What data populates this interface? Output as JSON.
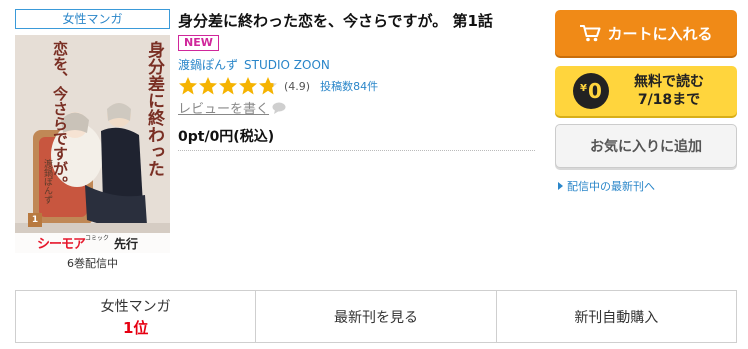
{
  "genre_tag": "女性マンガ",
  "cover": {
    "title_lines": [
      "身分差に",
      "終わった",
      "恋を、",
      "今さら",
      "ですが。"
    ],
    "author": "渡鍋ぽんず",
    "volume": "1",
    "label": "シーモア",
    "label_small": "コミック",
    "label_sub": "先行"
  },
  "volume_status": "6巻配信中",
  "product": {
    "title": "身分差に終わった恋を、今さらですが。 第1話",
    "new_badge": "NEW",
    "authors": [
      "渡鍋ぽんず",
      "STUDIO ZOON"
    ],
    "rating": {
      "value": 4.9,
      "stars": 5,
      "display": "(4.9)"
    },
    "review_count": "投稿数84件",
    "review_link": "レビューを書く",
    "price": "0pt/0円(税込)"
  },
  "buttons": {
    "cart": "カートに入れる",
    "free_amount": "0",
    "free_yen": "¥",
    "free_line1": "無料で読む",
    "free_line2": "7/18まで",
    "favorite": "お気に入りに追加"
  },
  "latest_link": "配信中の最新刊へ",
  "bottom": {
    "genre_label": "女性マンガ",
    "rank": "1位",
    "latest": "最新刊を見る",
    "auto_buy": "新刊自動購入"
  },
  "colors": {
    "accent_blue": "#2a86c9",
    "cart_orange": "#f08a17",
    "free_yellow": "#ffd53d",
    "new_magenta": "#d0279b",
    "rank_red": "#e60012",
    "star_gold": "#f5b301"
  }
}
